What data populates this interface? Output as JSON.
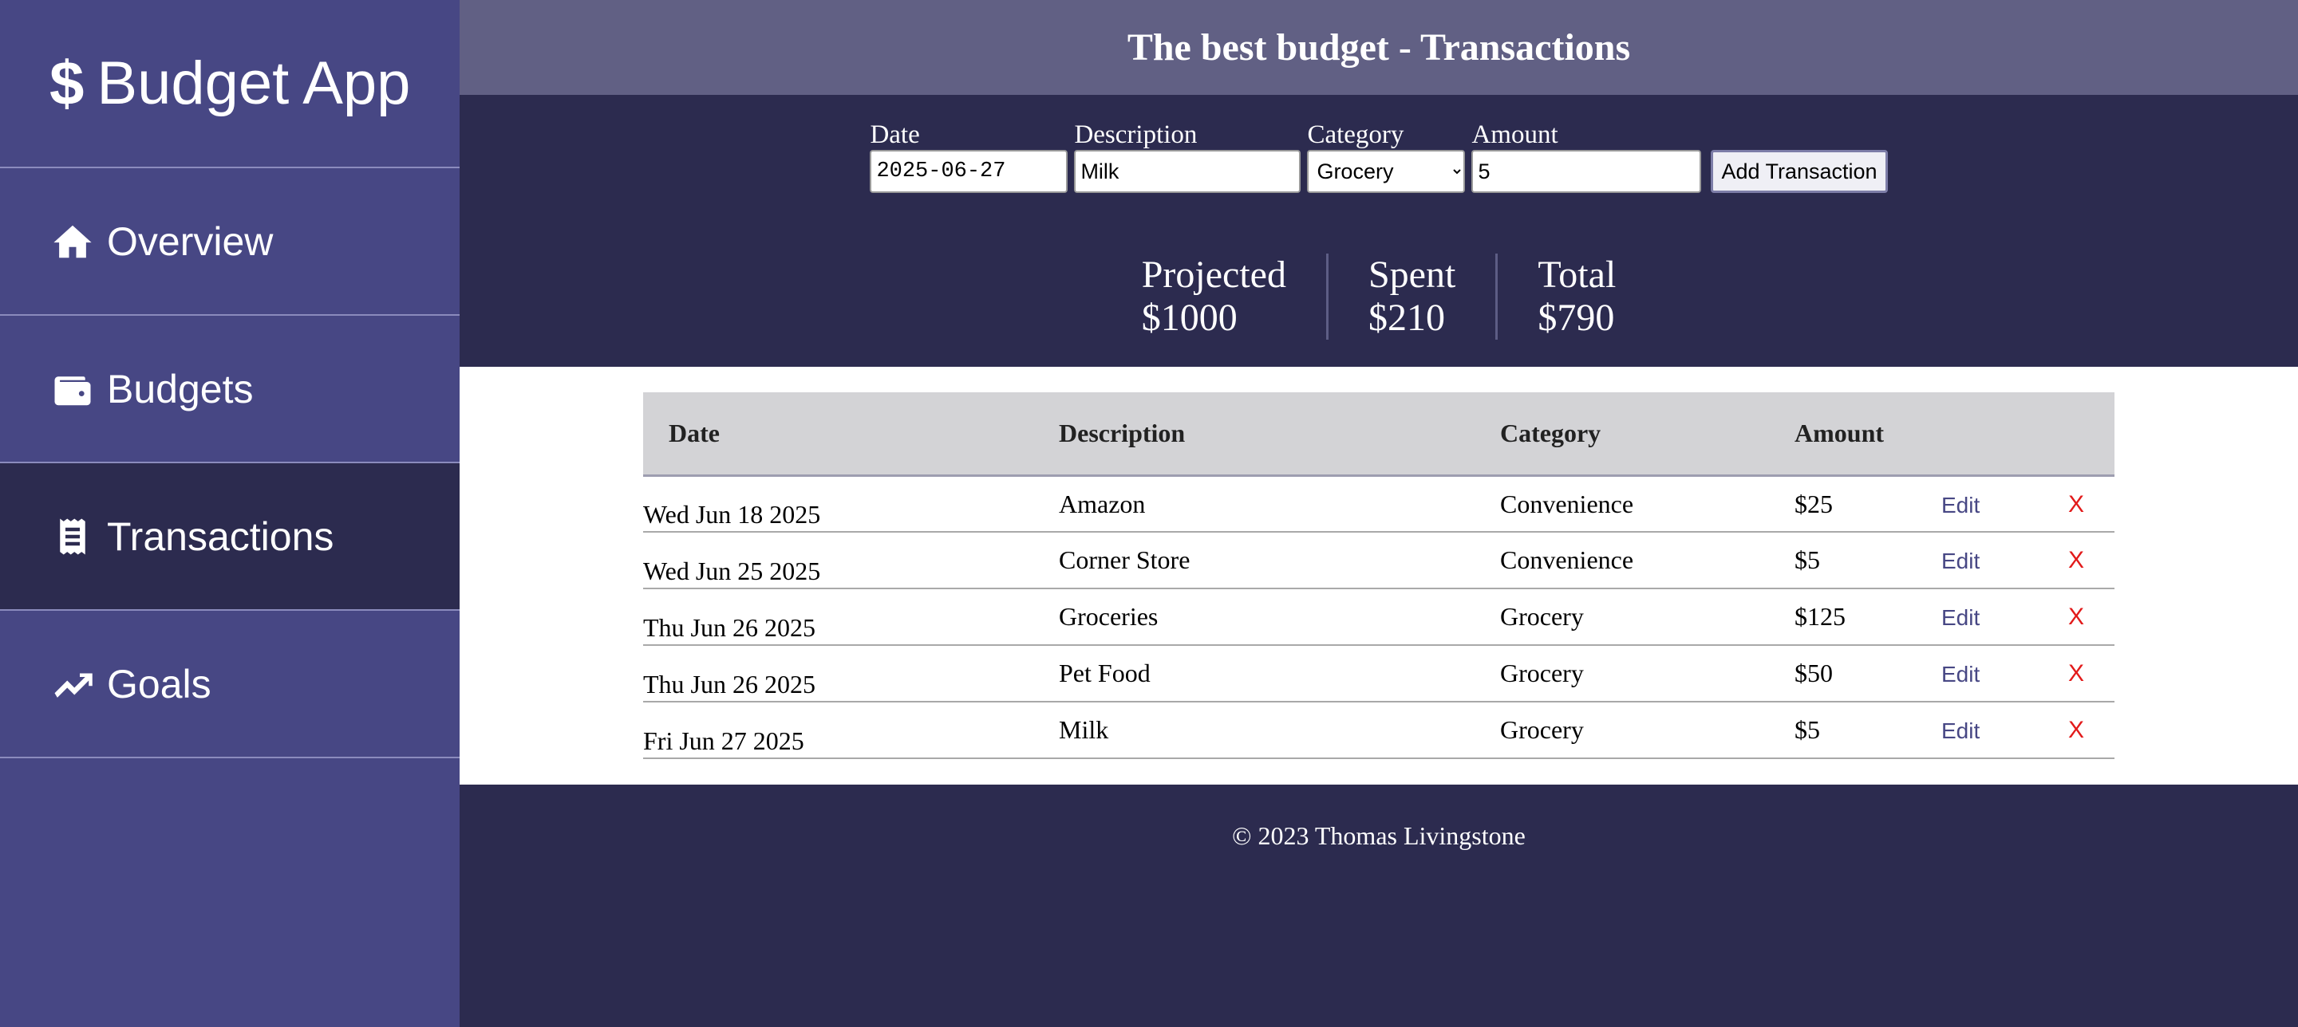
{
  "sidebar": {
    "brand": {
      "icon": "dollar-icon",
      "symbol": "$",
      "title": "Budget App"
    },
    "items": [
      {
        "icon": "home-icon",
        "label": "Overview"
      },
      {
        "icon": "wallet-icon",
        "label": "Budgets"
      },
      {
        "icon": "receipt-icon",
        "label": "Transactions",
        "active": true
      },
      {
        "icon": "trending-up-icon",
        "label": "Goals"
      }
    ]
  },
  "header": {
    "title": "The best budget - Transactions"
  },
  "form": {
    "date_label": "Date",
    "date_value": "2025-06-27",
    "description_label": "Description",
    "description_value": "Milk",
    "category_label": "Category",
    "category_value": "Grocery",
    "amount_label": "Amount",
    "amount_value": "5",
    "add_button": "Add Transaction"
  },
  "stats": [
    {
      "label": "Projected",
      "value": "$1000"
    },
    {
      "label": "Spent",
      "value": "$210"
    },
    {
      "label": "Total",
      "value": "$790"
    }
  ],
  "table": {
    "headers": [
      "Date",
      "Description",
      "Category",
      "Amount"
    ],
    "edit_label": "Edit",
    "delete_label": "X",
    "rows": [
      {
        "date": "Wed Jun 18 2025",
        "description": "Amazon",
        "category": "Convenience",
        "amount": "$25"
      },
      {
        "date": "Wed Jun 25 2025",
        "description": "Corner Store",
        "category": "Convenience",
        "amount": "$5"
      },
      {
        "date": "Thu Jun 26 2025",
        "description": "Groceries",
        "category": "Grocery",
        "amount": "$125"
      },
      {
        "date": "Thu Jun 26 2025",
        "description": "Pet Food",
        "category": "Grocery",
        "amount": "$50"
      },
      {
        "date": "Fri Jun 27 2025",
        "description": "Milk",
        "category": "Grocery",
        "amount": "$5"
      }
    ]
  },
  "footer": {
    "text": "© 2023 Thomas Livingstone"
  },
  "colors": {
    "sidebar": "#474784",
    "dark": "#2c2b4f",
    "header": "#616084",
    "edit": "#474784",
    "delete": "#e21a1a"
  }
}
